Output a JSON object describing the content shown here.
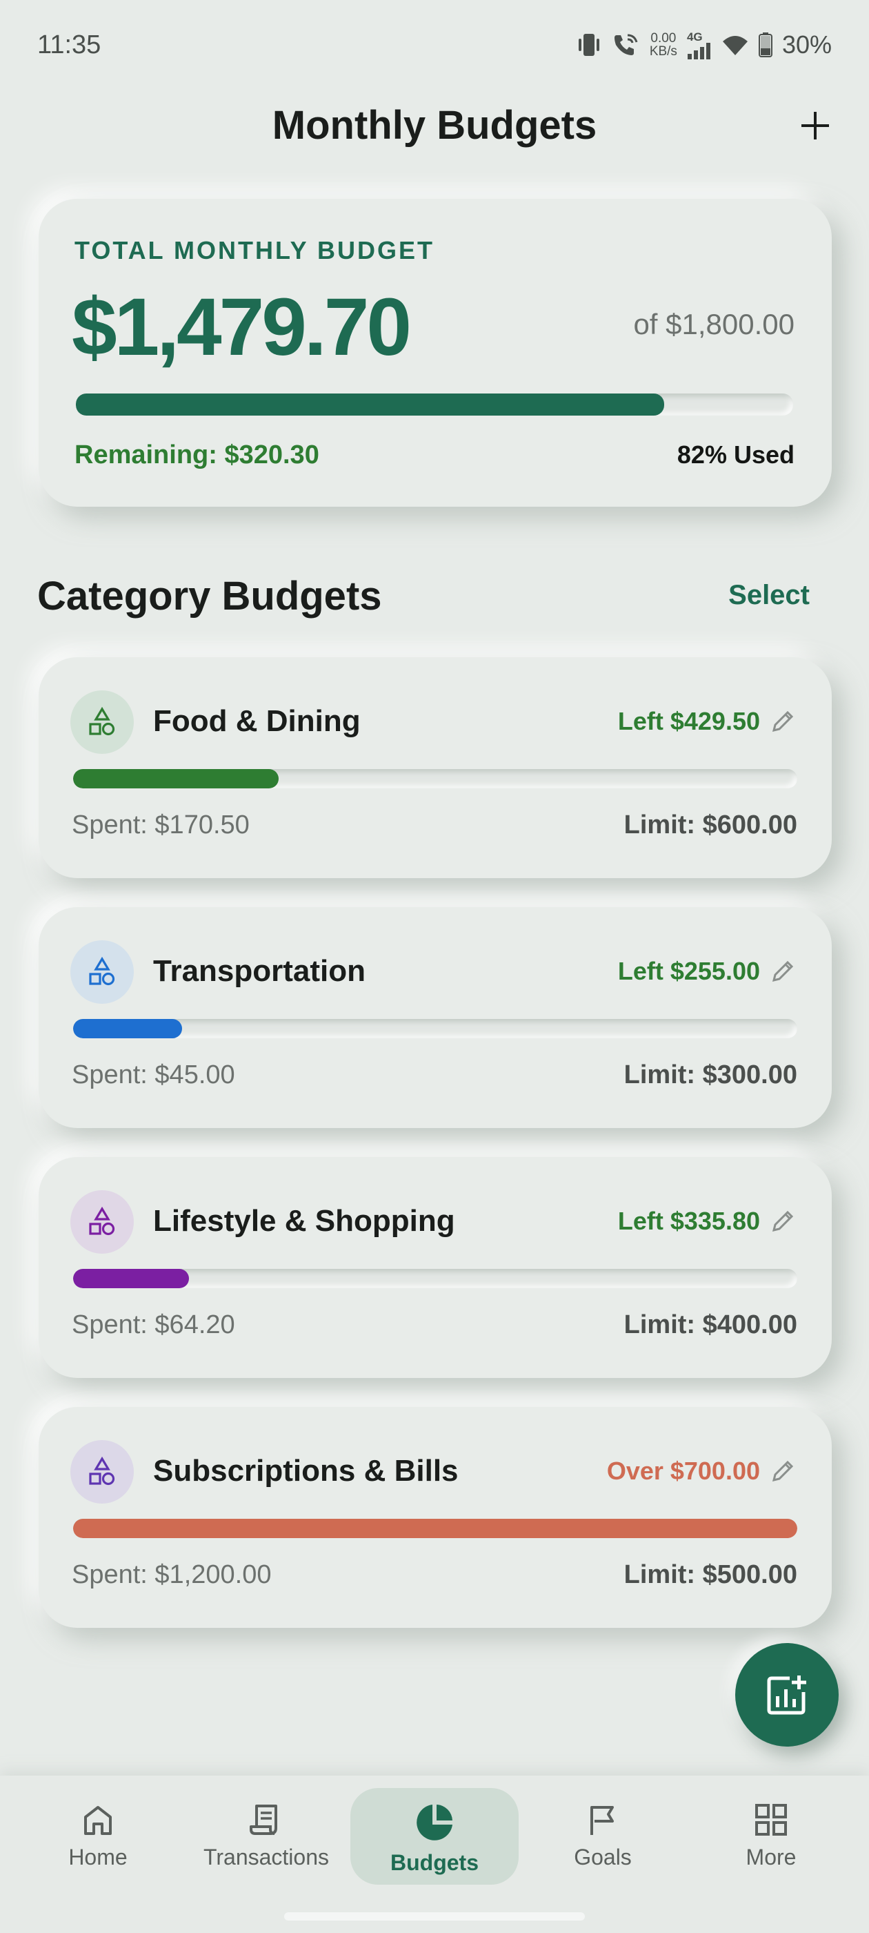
{
  "status_bar": {
    "time": "11:35",
    "net_speed": "0.00",
    "net_unit": "KB/s",
    "network_type": "4G",
    "battery": "30%"
  },
  "header": {
    "title": "Monthly Budgets",
    "add_icon": "plus-icon"
  },
  "summary": {
    "label": "TOTAL MONTHLY BUDGET",
    "amount": "$1,479.70",
    "of_total": "of $1,800.00",
    "progress": 0.82,
    "remaining": "Remaining: $320.30",
    "used": "82% Used",
    "color": "#1e6b52"
  },
  "categories_section": {
    "title": "Category Budgets",
    "select_label": "Select"
  },
  "categories": [
    {
      "name": "Food & Dining",
      "status": "Left $429.50",
      "spent": "Spent: $170.50",
      "limit": "Limit: $600.00",
      "progress": 0.284,
      "bar_color": "#2e7d32",
      "icon_bg": "#d3e2d7",
      "icon_color": "#2e7d32",
      "status_color": "#2e7d32",
      "icon": "shapes-icon"
    },
    {
      "name": "Transportation",
      "status": "Left $255.00",
      "spent": "Spent: $45.00",
      "limit": "Limit: $300.00",
      "progress": 0.15,
      "bar_color": "#1e6fd0",
      "icon_bg": "#d4e1ec",
      "icon_color": "#1e6fd0",
      "status_color": "#2e7d32",
      "icon": "shapes-icon"
    },
    {
      "name": "Lifestyle & Shopping",
      "status": "Left $335.80",
      "spent": "Spent: $64.20",
      "limit": "Limit: $400.00",
      "progress": 0.16,
      "bar_color": "#7b1fa2",
      "icon_bg": "#e0d7e6",
      "icon_color": "#7b1fa2",
      "status_color": "#2e7d32",
      "icon": "shapes-icon"
    },
    {
      "name": "Subscriptions & Bills",
      "status": "Over $700.00",
      "spent": "Spent: $1,200.00",
      "limit": "Limit: $500.00",
      "progress": 1.0,
      "bar_color": "#cf6b52",
      "icon_bg": "#dcd8e8",
      "icon_color": "#5e35b1",
      "status_color": "#cf6b52",
      "icon": "shapes-icon"
    }
  ],
  "fab": {
    "icon": "add-chart-icon"
  },
  "nav": [
    {
      "label": "Home",
      "icon": "home-icon",
      "active": false
    },
    {
      "label": "Transactions",
      "icon": "receipt-icon",
      "active": false
    },
    {
      "label": "Budgets",
      "icon": "pie-chart-icon",
      "active": true
    },
    {
      "label": "Goals",
      "icon": "flag-icon",
      "active": false
    },
    {
      "label": "More",
      "icon": "grid-icon",
      "active": false
    }
  ]
}
